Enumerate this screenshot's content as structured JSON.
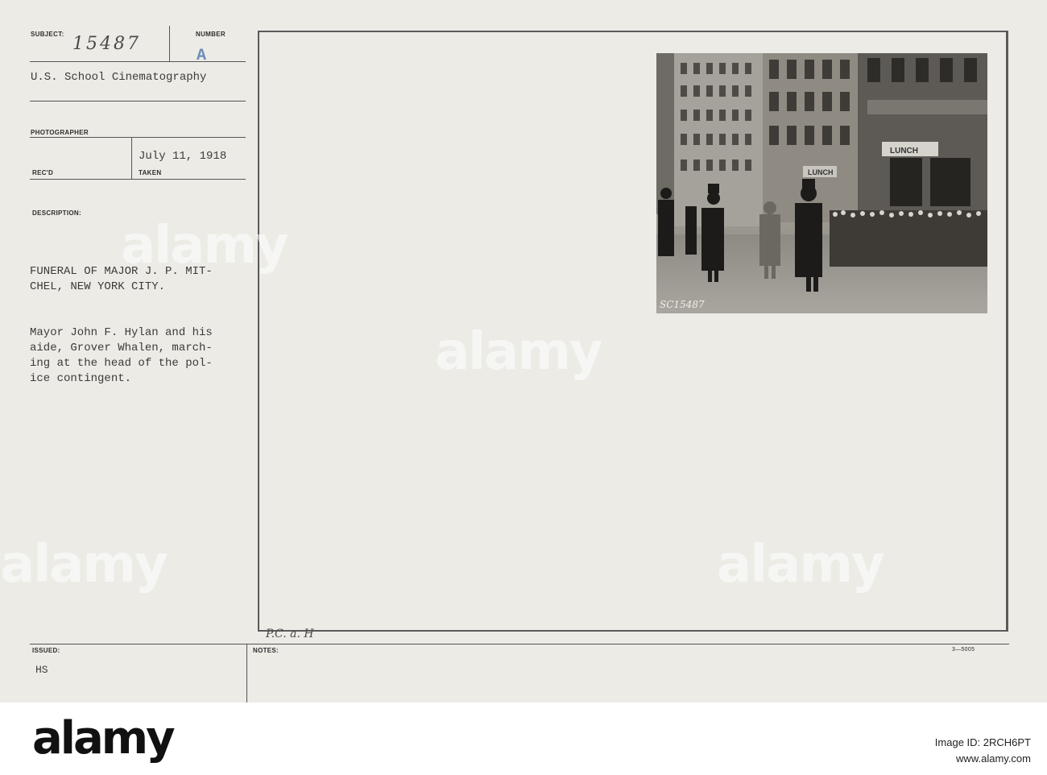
{
  "card": {
    "subject_label": "SUBJECT:",
    "subject_value": "15487",
    "number_label": "NUMBER",
    "number_value": "A",
    "source": "U.S. School Cinematography",
    "photographer_label": "PHOTOGRAPHER",
    "date": "July 11, 1918",
    "recd_label": "REC'D",
    "taken_label": "TAKEN",
    "description_label": "DESCRIPTION:",
    "description_title": "FUNERAL OF MAJOR J. P. MIT-\nCHEL, NEW YORK CITY.",
    "description_body": "Mayor John F. Hylan and his\naide, Grover Whalen, march-\ning at the head of the pol-\nice contingent.",
    "issued_label": "ISSUED:",
    "issued_value": "HS",
    "notes_label": "NOTES:",
    "notes_handwriting": "P.C. a. H",
    "form_number": "3—5005"
  },
  "photo": {
    "negative_number": "SC15487",
    "sign_lunch": "LUNCH",
    "sign_shop": "LUNCH"
  },
  "watermark": {
    "text": "alamy"
  },
  "footer": {
    "logo": "alamy",
    "image_id": "Image ID: 2RCH6PT",
    "site": "www.alamy.com"
  },
  "colors": {
    "card_background": "#ecebe6",
    "number_stamp": "#6a8fb8",
    "line": "#555555"
  }
}
